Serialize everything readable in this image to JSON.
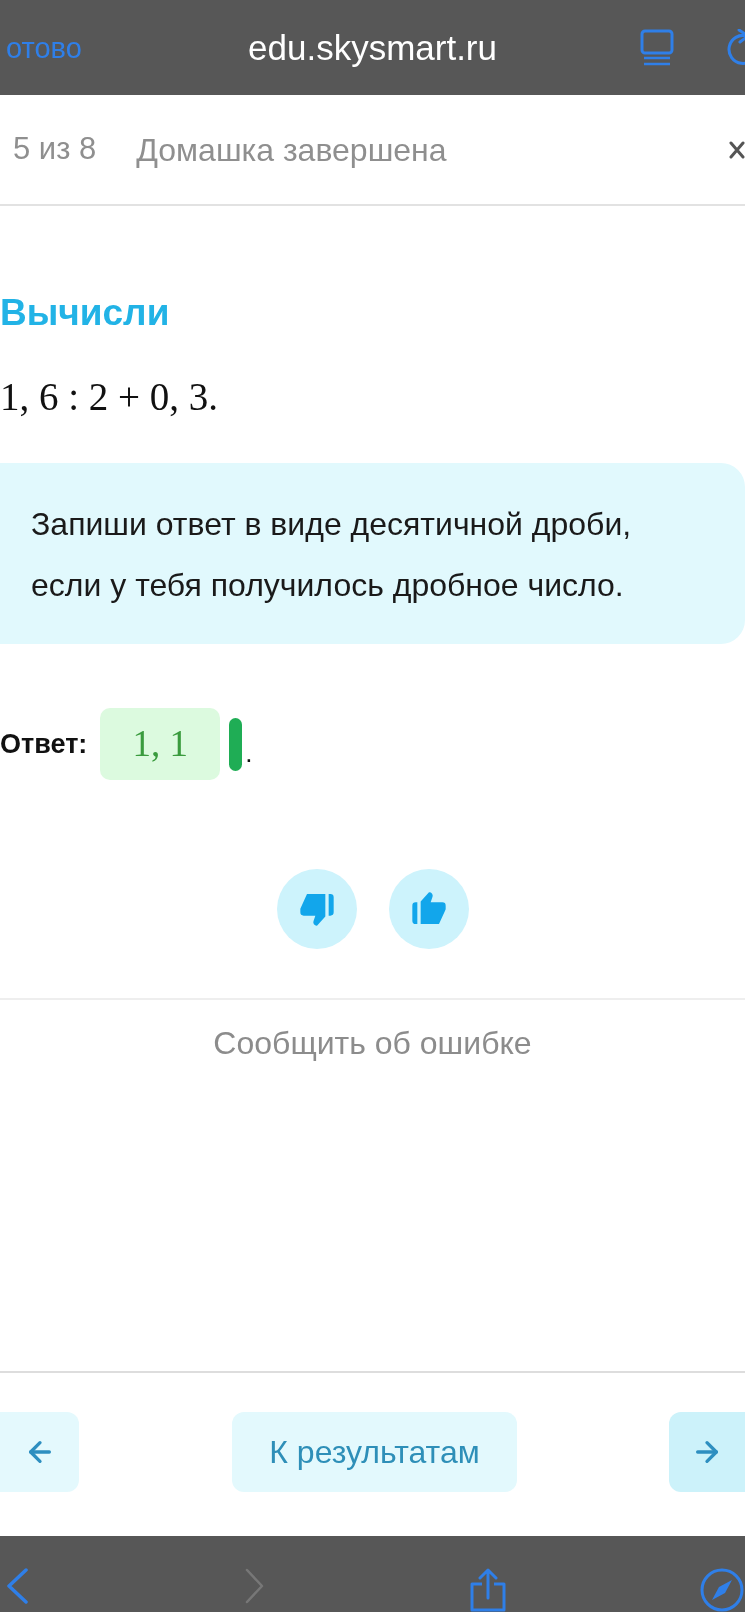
{
  "browser_top": {
    "done_button": "отово",
    "url": "edu.skysmart.ru"
  },
  "header": {
    "progress": "5 из 8",
    "title": "Домашка завершена"
  },
  "task": {
    "title": "Вычисли",
    "expression": "1, 6 : 2 + 0, 3.",
    "hint": "Запиши ответ в виде десятичной дроби, если у тебя получилось дробное число."
  },
  "answer": {
    "label": "Ответ:",
    "value": "1, 1",
    "correct": true,
    "suffix": "."
  },
  "report_link": "Сообщить об ошибке",
  "navigation": {
    "results_button": "К результатам"
  },
  "browser_toolbar": [
    {
      "kind": "back",
      "disabled": false
    },
    {
      "kind": "forward",
      "disabled": true
    },
    {
      "kind": "share",
      "disabled": false
    },
    {
      "kind": "compass",
      "disabled": false
    }
  ]
}
